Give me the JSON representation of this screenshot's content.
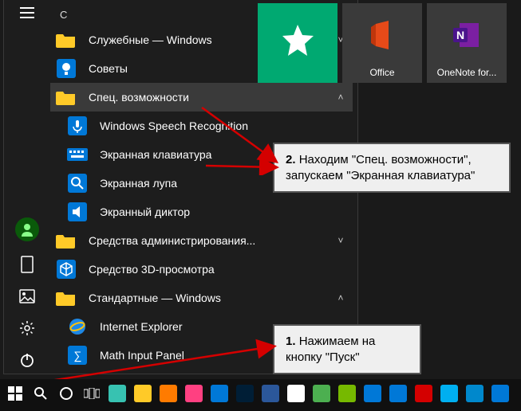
{
  "section_letter": "С",
  "menu": [
    {
      "label": "Служебные — Windows",
      "icon": "folder",
      "expand": "down"
    },
    {
      "label": "Советы",
      "icon": "bulb",
      "expand": ""
    },
    {
      "label": "Спец. возможности",
      "icon": "folder",
      "expand": "up",
      "selected": true
    },
    {
      "label": "Windows Speech Recognition",
      "icon": "mic",
      "sub": true
    },
    {
      "label": "Экранная клавиатура",
      "icon": "keyboard",
      "sub": true
    },
    {
      "label": "Экранная лупа",
      "icon": "magnifier",
      "sub": true
    },
    {
      "label": "Экранный диктор",
      "icon": "narrator",
      "sub": true
    },
    {
      "label": "Средства администрирования...",
      "icon": "folder",
      "expand": "down"
    },
    {
      "label": "Средство 3D-просмотра",
      "icon": "cube",
      "expand": ""
    },
    {
      "label": "Стандартные — Windows",
      "icon": "folder",
      "expand": "up"
    },
    {
      "label": "Internet Explorer",
      "icon": "ie",
      "sub": true
    },
    {
      "label": "Math Input Panel",
      "icon": "math",
      "sub": true
    }
  ],
  "tiles": [
    {
      "caption": "",
      "color": "#00a971",
      "icon": "star"
    },
    {
      "caption": "Office",
      "color": "#3a3a3a",
      "icon": "office"
    },
    {
      "caption": "OneNote for...",
      "color": "#3a3a3a",
      "icon": "onenote"
    }
  ],
  "callouts": {
    "c1_num": "2.",
    "c1_text": "Находим \"Спец. возможности\", запускаем \"Экранная клавиатура\"",
    "c2_num": "1.",
    "c2_text": "Нажимаем на кнопку \"Пуск\""
  },
  "taskbar_items": [
    "start",
    "search",
    "cortana",
    "taskview",
    "edge",
    "explorer",
    "firefox",
    "paint",
    "mail",
    "photoshop",
    "word",
    "chrome",
    "app1",
    "utorrent",
    "calc",
    "defender",
    "opera",
    "skype",
    "telegram",
    "app2"
  ],
  "colors": {
    "fg": "#ffffff",
    "sel_bg": "#3a3a3a",
    "accent": "#0078d7",
    "arrow": "#d40000"
  }
}
